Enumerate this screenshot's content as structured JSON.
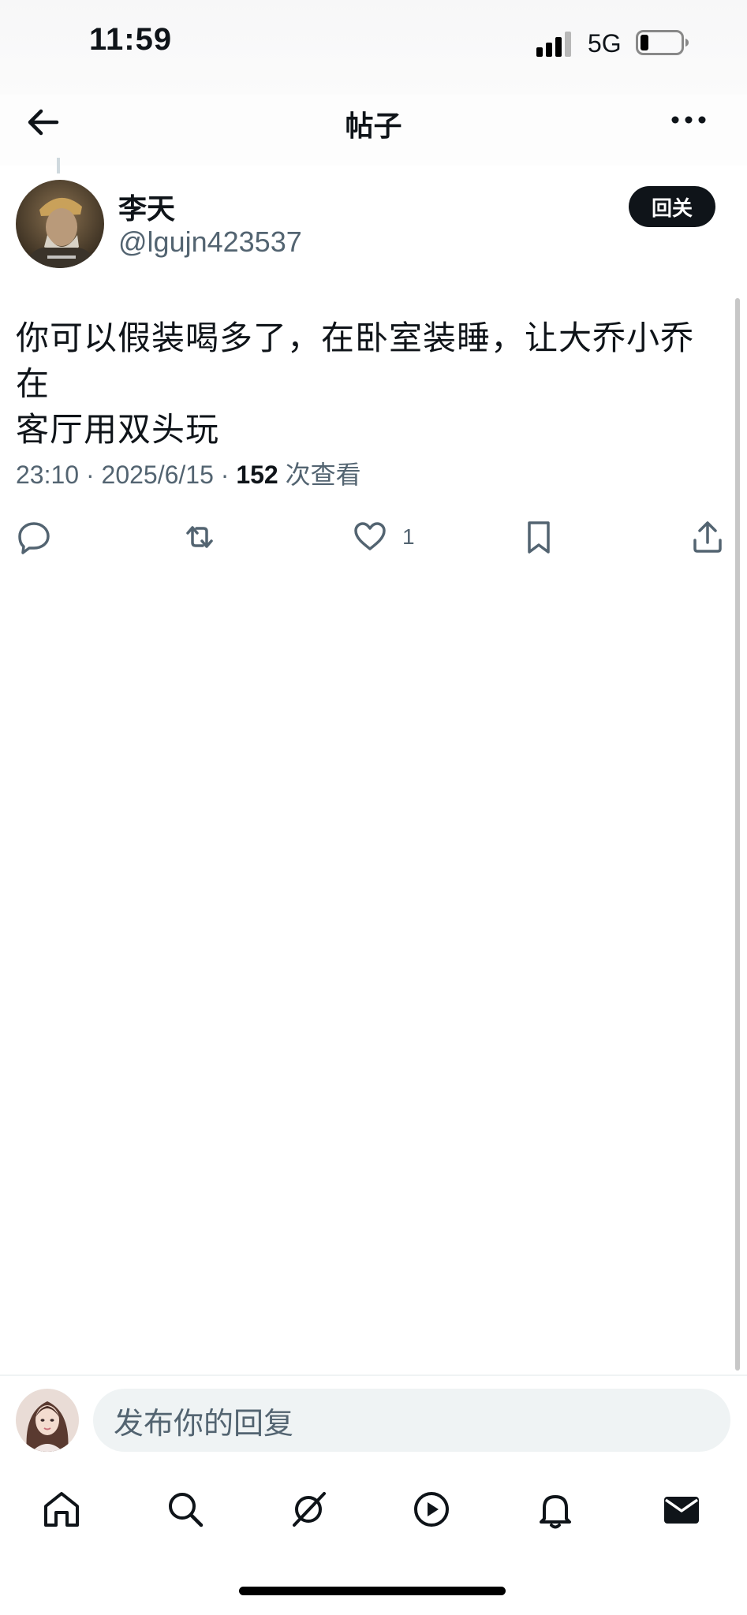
{
  "status_bar": {
    "time": "11:59",
    "network": "5G"
  },
  "header": {
    "title": "帖子"
  },
  "post": {
    "author_name": "李天",
    "author_handle": "@lgujn423537",
    "follow_label": "回关",
    "text_line1": "你可以假装喝多了，在卧室装睡，让大乔小乔在",
    "text_line2": "客厅用双头玩",
    "time": "23:10",
    "date": "2025/6/15",
    "views": "152",
    "views_label": "次查看",
    "like_count": "1"
  },
  "reply": {
    "placeholder": "发布你的回复"
  },
  "tabs": [
    "home-icon",
    "search-icon",
    "grok-icon",
    "video-icon",
    "notifications-icon",
    "messages-icon"
  ],
  "colors": {
    "text": "#0f1419",
    "secondary": "#536471",
    "input_bg": "#eff3f4"
  }
}
